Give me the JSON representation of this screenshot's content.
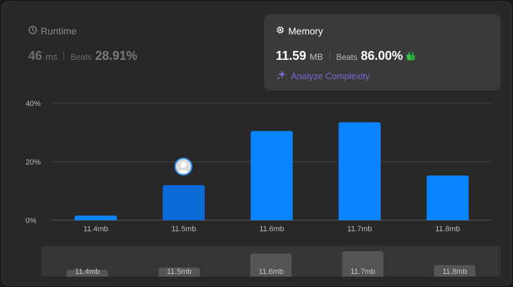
{
  "runtime": {
    "title": "Runtime",
    "value": "46",
    "unit": "ms",
    "beats_label": "Beats",
    "beats_value": "28.91%"
  },
  "memory": {
    "title": "Memory",
    "value": "11.59",
    "unit": "MB",
    "beats_label": "Beats",
    "beats_value": "86.00%",
    "badge_icon": "clapping-hands-icon"
  },
  "analyze": {
    "label": "Analyze Complexity",
    "icon": "sparkle-icon"
  },
  "colors": {
    "bar": "#0a84ff",
    "bar_selected": "#0b6ad6",
    "accent_purple": "#7b6ad8",
    "clap_green": "#36c24a"
  },
  "chart_data": {
    "type": "bar",
    "categories": [
      "11.4mb",
      "11.5mb",
      "11.6mb",
      "11.7mb",
      "11.8mb"
    ],
    "values": [
      1.6,
      12,
      30.5,
      33.5,
      15.3
    ],
    "ylim": [
      0,
      40
    ],
    "yticks": [
      "0%",
      "20%",
      "40%"
    ],
    "ytick_values": [
      0,
      20,
      40
    ],
    "selected_category": "11.5mb",
    "grid": true
  },
  "navigator_labels": [
    "11.4mb",
    "11.5mb",
    "11.6mb",
    "11.7mb",
    "11.8mb"
  ]
}
